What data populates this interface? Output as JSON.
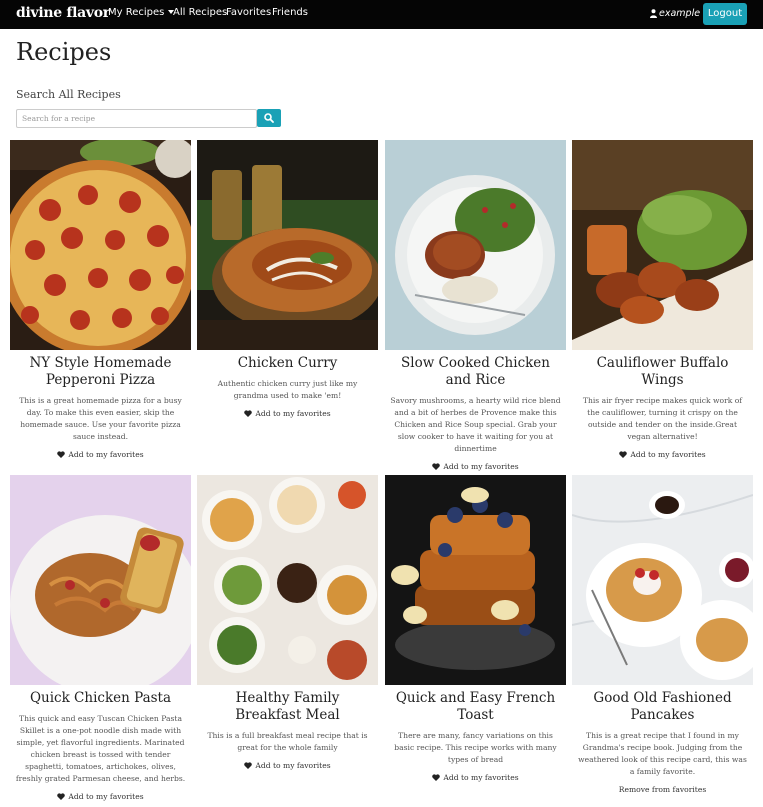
{
  "navbar": {
    "brand": "divine flavor",
    "my_recipes": "My Recipes",
    "all_recipes": "All Recipes",
    "favorites": "Favorites",
    "friends": "Friends",
    "user_name": "example",
    "logout": "Logout"
  },
  "page": {
    "title": "Recipes",
    "search_label": "Search All Recipes",
    "search_placeholder": "Search for a recipe"
  },
  "colors": {
    "navbar_bg": "#050505",
    "accent": "#1aa1b6"
  },
  "recipes": [
    {
      "title": "NY Style Homemade Pepperoni Pizza",
      "description": "This is a great homemade pizza for a busy day. To make this even easier, skip the homemade sauce. Use your favorite pizza sauce instead.",
      "action": "Add to my favorites",
      "image_icon": "pepperoni-pizza-photo"
    },
    {
      "title": "Chicken Curry",
      "description": "Authentic chicken curry just like my grandma used to make 'em!",
      "action": "Add to my favorites",
      "image_icon": "chicken-curry-photo"
    },
    {
      "title": "Slow Cooked Chicken and Rice",
      "description": "Savory mushrooms, a hearty wild rice blend and a bit of herbes de Provence make this Chicken and Rice Soup special. Grab your slow cooker to have it waiting for you at dinnertime",
      "action": "Add to my favorites",
      "image_icon": "roast-chicken-photo"
    },
    {
      "title": "Cauliflower Buffalo Wings",
      "description": "This air fryer recipe makes quick work of the cauliflower, turning it crispy on the outside and tender on the inside.Great vegan alternative!",
      "action": "Add to my favorites",
      "image_icon": "buffalo-wings-photo"
    },
    {
      "title": "Quick Chicken Pasta",
      "description": "This quick and easy Tuscan Chicken Pasta Skillet is a one-pot noodle dish made with simple, yet flavorful ingredients. Marinated chicken breast is tossed with tender spaghetti, tomatoes, artichokes, olives, freshly grated Parmesan cheese, and herbs.",
      "action": "Add to my favorites",
      "image_icon": "chicken-pasta-photo"
    },
    {
      "title": "Healthy Family Breakfast Meal",
      "description": "This is a full breakfast meal recipe that is great for the whole family",
      "action": "Add to my favorites",
      "image_icon": "breakfast-spread-photo"
    },
    {
      "title": "Quick and Easy French Toast",
      "description": "There are many, fancy variations on this basic recipe. This recipe works with many types of bread",
      "action": "Add to my favorites",
      "image_icon": "french-toast-photo"
    },
    {
      "title": "Good Old Fashioned Pancakes",
      "description": "This is a great recipe that I found in my Grandma's recipe book. Judging from the weathered look of this recipe card, this was a family favorite.",
      "action": "Remove from favorites",
      "image_icon": "pancakes-photo"
    }
  ]
}
